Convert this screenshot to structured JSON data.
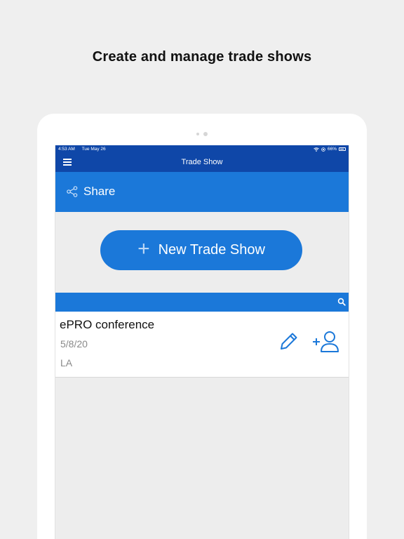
{
  "headline": "Create and manage trade shows",
  "status_bar": {
    "time": "4:53 AM",
    "date": "Tue May 26",
    "battery": "66%"
  },
  "nav": {
    "title": "Trade Show",
    "menu_icon": "hamburger-menu-icon"
  },
  "share": {
    "label": "Share",
    "icon": "share-icon"
  },
  "new_button": {
    "label": "New Trade Show",
    "icon": "plus-icon"
  },
  "search": {
    "icon": "search-icon"
  },
  "trade_shows": [
    {
      "name": "ePRO conference",
      "date": "5/8/20",
      "location": "LA",
      "actions": [
        "pencil-icon",
        "add-user-icon"
      ]
    }
  ],
  "colors": {
    "nav": "#0f47a8",
    "accent": "#1b78d9",
    "background": "#efefef",
    "screen_bg": "#ededed"
  }
}
